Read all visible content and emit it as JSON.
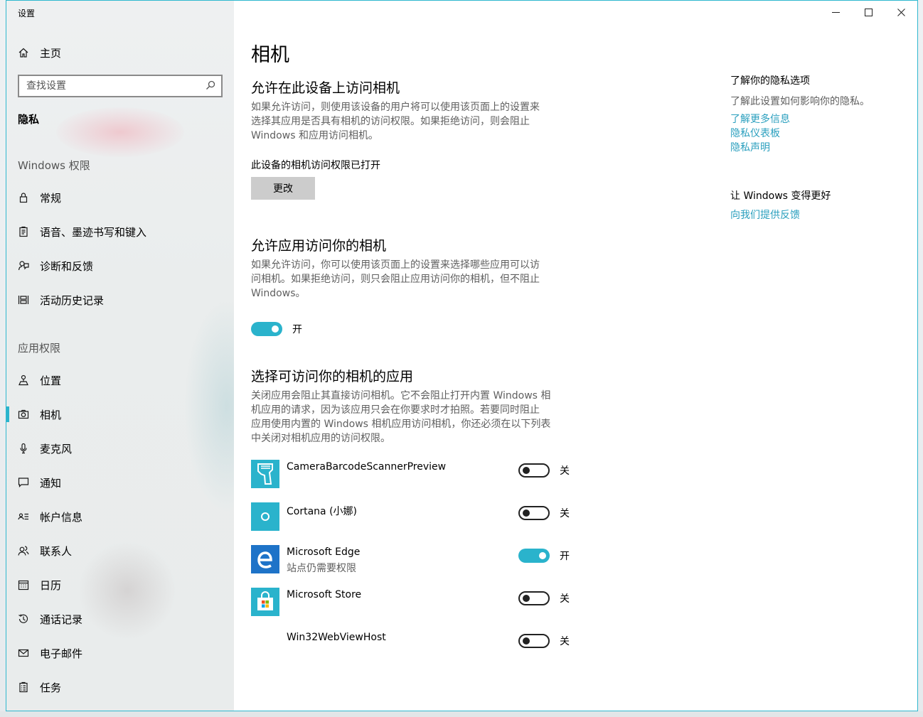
{
  "window": {
    "title": "设置"
  },
  "sidebar": {
    "home_label": "主页",
    "search_placeholder": "查找设置",
    "section_title": "隐私",
    "group_windows": "Windows 权限",
    "group_app": "应用权限",
    "windows_items": [
      {
        "label": "常规",
        "icon": "lock-icon"
      },
      {
        "label": "语音、墨迹书写和键入",
        "icon": "clipboard-icon"
      },
      {
        "label": "诊断和反馈",
        "icon": "feedback-icon"
      },
      {
        "label": "活动历史记录",
        "icon": "timeline-icon"
      }
    ],
    "app_items": [
      {
        "label": "位置",
        "icon": "location-icon"
      },
      {
        "label": "相机",
        "icon": "camera-icon",
        "selected": true
      },
      {
        "label": "麦克风",
        "icon": "microphone-icon"
      },
      {
        "label": "通知",
        "icon": "notification-icon"
      },
      {
        "label": "帐户信息",
        "icon": "account-info-icon"
      },
      {
        "label": "联系人",
        "icon": "contacts-icon"
      },
      {
        "label": "日历",
        "icon": "calendar-icon"
      },
      {
        "label": "通话记录",
        "icon": "history-icon"
      },
      {
        "label": "电子邮件",
        "icon": "mail-icon"
      },
      {
        "label": "任务",
        "icon": "tasks-icon"
      }
    ]
  },
  "main": {
    "title": "相机",
    "device_section": {
      "heading": "允许在此设备上访问相机",
      "desc_lines": [
        "如果允许访问，则使用该设备的用户将可以使用该页面上的设置来",
        "选择其应用是否具有相机的访问权限。如果拒绝访问，则会阻止",
        "Windows 和应用访问相机。"
      ],
      "status": "此设备的相机访问权限已打开",
      "change_button": "更改"
    },
    "app_access_section": {
      "heading": "允许应用访问你的相机",
      "desc_lines": [
        "如果允许访问，你可以使用该页面上的设置来选择哪些应用可以访",
        "问相机。如果拒绝访问，则只会阻止应用访问你的相机，但不阻止",
        "Windows。"
      ],
      "toggle_state": "开",
      "toggle_on": true
    },
    "choose_apps_section": {
      "heading": "选择可访问你的相机的应用",
      "desc_lines": [
        "关闭应用会阻止其直接访问相机。它不会阻止打开内置 Windows 相",
        "机应用的请求，因为该应用只会在你要求时才拍照。若要同时阻止",
        "应用使用内置的 Windows 相机应用访问相机，你还必须在以下列表",
        "中关闭对相机应用的访问权限。"
      ],
      "apps": [
        {
          "name": "CameraBarcodeScannerPreview",
          "sub": "",
          "state": "关",
          "on": false,
          "icon": "barcode-scanner-icon",
          "color": "#2ab3cc"
        },
        {
          "name": "Cortana (小娜)",
          "sub": "",
          "state": "关",
          "on": false,
          "icon": "cortana-icon",
          "color": "#2ab3cc"
        },
        {
          "name": "Microsoft Edge",
          "sub": "站点仍需要权限",
          "state": "开",
          "on": true,
          "icon": "edge-icon",
          "color": "#1e73c8"
        },
        {
          "name": "Microsoft Store",
          "sub": "",
          "state": "关",
          "on": false,
          "icon": "store-icon",
          "color": "#2ab3cc"
        },
        {
          "name": "Win32WebViewHost",
          "sub": "",
          "state": "关",
          "on": false,
          "icon": "",
          "color": ""
        }
      ]
    }
  },
  "right_column": {
    "privacy_heading": "了解你的隐私选项",
    "privacy_text": "了解此设置如何影响你的隐私。",
    "links": [
      "了解更多信息",
      "隐私仪表板",
      "隐私声明"
    ],
    "improve_heading": "让 Windows 变得更好",
    "feedback_link": "向我们提供反馈"
  },
  "colors": {
    "accent": "#2ab3cc",
    "link": "#2a9fbe",
    "border": "#2fb8cf"
  }
}
